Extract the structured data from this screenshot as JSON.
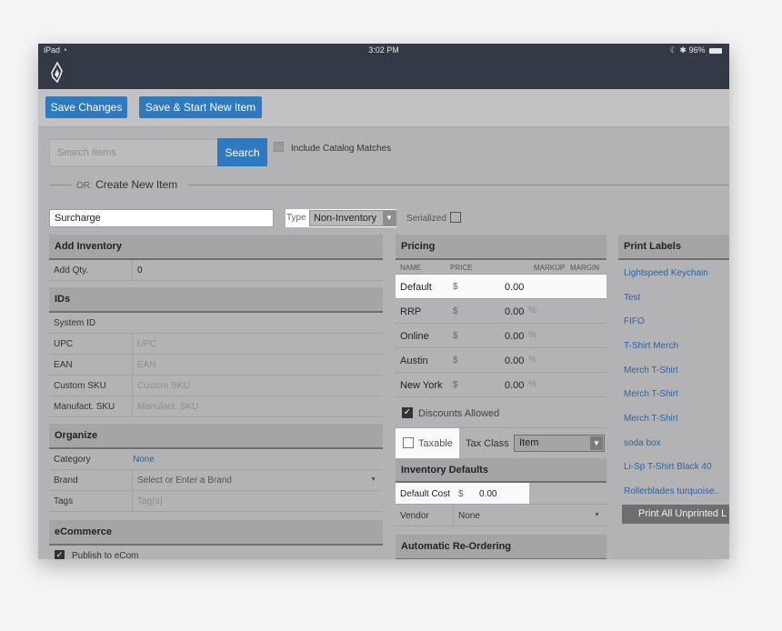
{
  "status_bar": {
    "device": "iPad",
    "wifi_icon": "wifi-icon",
    "time": "3:02 PM",
    "battery": "96%"
  },
  "toolbar": {
    "save_changes": "Save Changes",
    "save_start_new": "Save & Start New Item"
  },
  "search": {
    "placeholder": "Search Items",
    "button": "Search",
    "include_catalog": "Include Catalog Matches"
  },
  "create": {
    "or_label": "OR:",
    "title": "Create New Item"
  },
  "item": {
    "name": "Surcharge",
    "type_label": "Type",
    "type_value": "Non-Inventory",
    "serialized_label": "Serialized"
  },
  "add_inventory": {
    "header": "Add Inventory",
    "qty_label": "Add Qty.",
    "qty_value": "0"
  },
  "ids": {
    "header": "IDs",
    "system_id_label": "System ID",
    "rows": [
      {
        "label": "UPC",
        "placeholder": "UPC"
      },
      {
        "label": "EAN",
        "placeholder": "EAN"
      },
      {
        "label": "Custom SKU",
        "placeholder": "Custom SKU"
      },
      {
        "label": "Manufact. SKU",
        "placeholder": "Manufact. SKU"
      }
    ]
  },
  "organize": {
    "header": "Organize",
    "category_label": "Category",
    "category_value": "None",
    "brand_label": "Brand",
    "brand_value": "Select or Enter a Brand",
    "tags_label": "Tags",
    "tags_value": "Tag(s)"
  },
  "ecommerce": {
    "header": "eCommerce",
    "publish": "Publish to eCom"
  },
  "pricing": {
    "header": "Pricing",
    "columns": {
      "name": "NAME",
      "price": "PRICE",
      "markup": "MARKUP",
      "margin": "MARGIN"
    },
    "rows": [
      {
        "name": "Default",
        "currency": "$",
        "price": "0.00",
        "pct": ""
      },
      {
        "name": "RRP",
        "currency": "$",
        "price": "0.00",
        "pct": "%"
      },
      {
        "name": "Online",
        "currency": "$",
        "price": "0.00",
        "pct": "%"
      },
      {
        "name": "Austin",
        "currency": "$",
        "price": "0.00",
        "pct": "%"
      },
      {
        "name": "New York",
        "currency": "$",
        "price": "0.00",
        "pct": "%"
      }
    ],
    "discounts_allowed": "Discounts Allowed",
    "taxable": "Taxable",
    "tax_class_label": "Tax Class",
    "tax_class_value": "Item"
  },
  "inventory_defaults": {
    "header": "Inventory Defaults",
    "default_cost_label": "Default Cost",
    "default_cost_currency": "$",
    "default_cost_value": "0.00",
    "vendor_label": "Vendor",
    "vendor_value": "None"
  },
  "auto_reorder": {
    "header": "Automatic Re-Ordering"
  },
  "print_labels": {
    "header": "Print Labels",
    "items": [
      "Lightspeed Keychain",
      "Test",
      "FIFO",
      "T-Shirt Merch",
      "Merch T-Shirt",
      "Merch T-Shirt",
      "Merch T-Shirt",
      "soda box",
      "Li-Sp T-Shirt Black 40",
      "Rollerblades turquoise.."
    ],
    "print_all": "Print All Unprinted L"
  },
  "colors": {
    "accent": "#2f79bf",
    "header_bar": "#333a45",
    "link": "#2c63a5"
  }
}
